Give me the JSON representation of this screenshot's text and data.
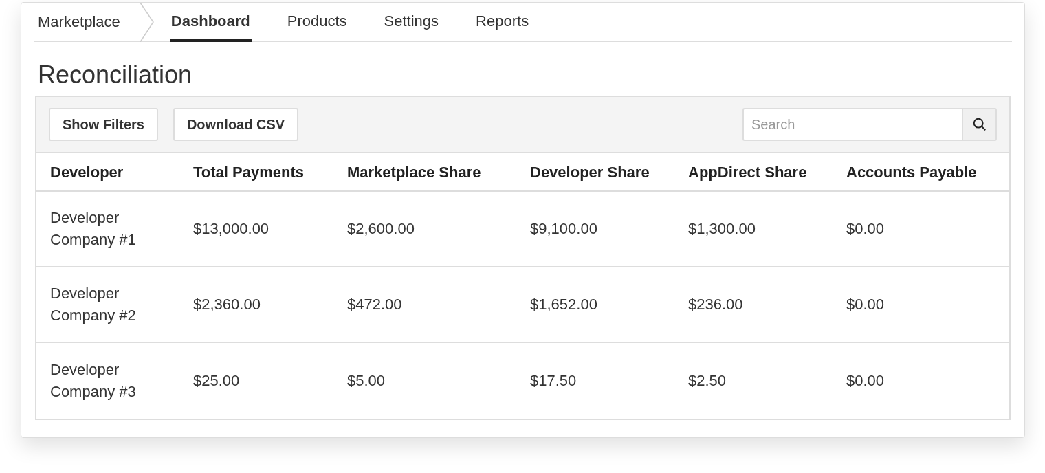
{
  "breadcrumb": {
    "label": "Marketplace"
  },
  "tabs": [
    {
      "label": "Dashboard",
      "selected": true
    },
    {
      "label": "Products",
      "selected": false
    },
    {
      "label": "Settings",
      "selected": false
    },
    {
      "label": "Reports",
      "selected": false
    }
  ],
  "title": "Reconciliation",
  "toolbar": {
    "buttons": [
      "Show Filters",
      "Download CSV"
    ],
    "search": {
      "placeholder": "Search"
    }
  },
  "table": {
    "columns": [
      "Developer",
      "Total Payments",
      "Marketplace Share",
      "Developer Share",
      "AppDirect Share",
      "Accounts Payable"
    ],
    "rows": [
      [
        "Developer Company #1",
        "$13,000.00",
        "$2,600.00",
        "$9,100.00",
        "$1,300.00",
        "$0.00"
      ],
      [
        "Developer Company #2",
        "$2,360.00",
        "$472.00",
        "$1,652.00",
        "$236.00",
        "$0.00"
      ],
      [
        "Developer Company #3",
        "$25.00",
        "$5.00",
        "$17.50",
        "$2.50",
        "$0.00"
      ]
    ]
  }
}
